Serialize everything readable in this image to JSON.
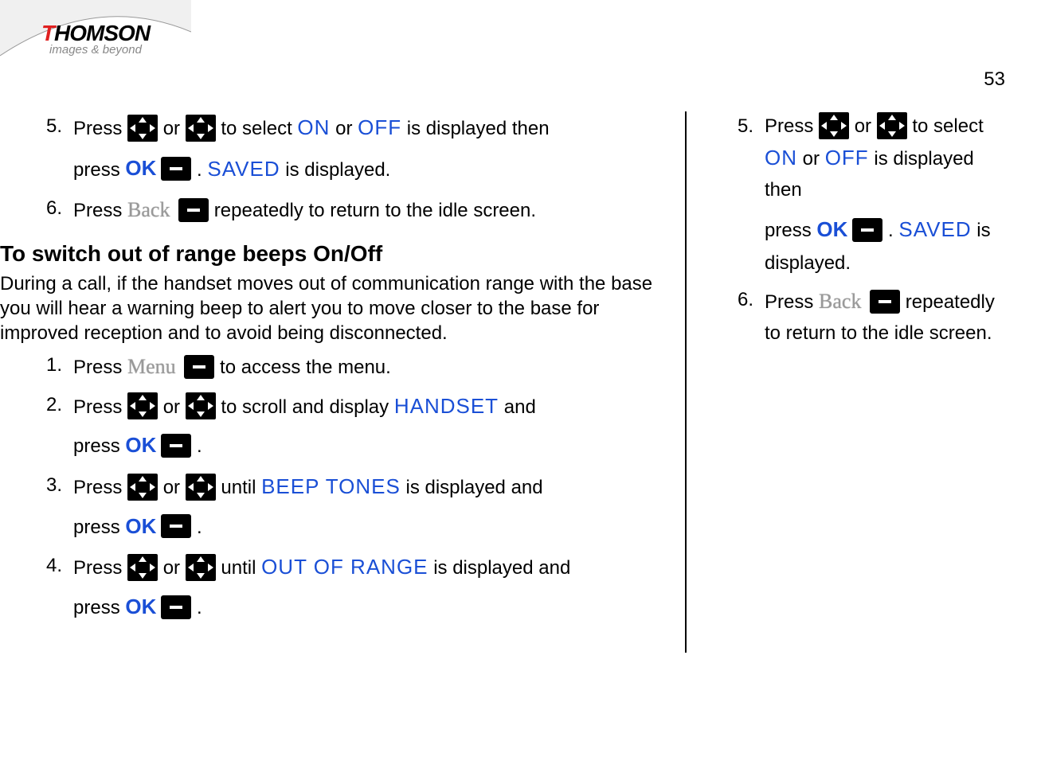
{
  "logo": {
    "brand_t": "T",
    "brand_rest": "HOMSON",
    "sub": "images & beyond"
  },
  "page_number": "53",
  "left": {
    "step5": {
      "num": "5.",
      "t1": "Press ",
      "or": "or ",
      "t2": " to select ",
      "on": "ON",
      "or2": " or ",
      "off": "OFF",
      "t3": " is displayed then",
      "t4": "press ",
      "period": " . ",
      "saved": " SAVED",
      "t5": " is displayed."
    },
    "step6": {
      "num": "6.",
      "t1": "Press ",
      "back": "Back",
      "t2": " repeatedly to return to the idle screen."
    },
    "section_title": "To switch out of range beeps On/Off",
    "section_intro": "During a call, if the handset moves out of communication range with the base you will hear a warning beep to alert you to move closer to the base for improved reception and to avoid being disconnected.",
    "b_step1": {
      "num": "1.",
      "t1": "Press ",
      "menu": "Menu",
      "t2": "to access the menu."
    },
    "b_step2": {
      "num": "2.",
      "t1": "Press ",
      "or": "or ",
      "t2": " to scroll and display ",
      "handset": "HANDSET",
      "and": "and",
      "t3": "press ",
      "period": " ."
    },
    "b_step3": {
      "num": "3.",
      "t1": "Press ",
      "or": "or ",
      "t2": " until ",
      "beep": "BEEP TONES",
      "t3": " is displayed and",
      "t4": "press ",
      "period": " ."
    },
    "b_step4": {
      "num": "4.",
      "t1": "Press ",
      "or": "or ",
      "t2": " until ",
      "oor": "OUT OF RANGE",
      "t3": " is displayed and",
      "t4": "press ",
      "period": " ."
    }
  },
  "right": {
    "step5": {
      "num": "5.",
      "t1": "Press ",
      "or": "or ",
      "t2": " to select ",
      "on": "ON",
      "or2": " or ",
      "off": "OFF",
      "t3": " is displayed then",
      "t4": "press ",
      "period": " . ",
      "saved": " SAVED",
      "t5": " is displayed."
    },
    "step6": {
      "num": "6.",
      "t1": "Press ",
      "back": "Back",
      "t2": " repeatedly to return to the idle screen."
    }
  },
  "ok_text": "OK"
}
